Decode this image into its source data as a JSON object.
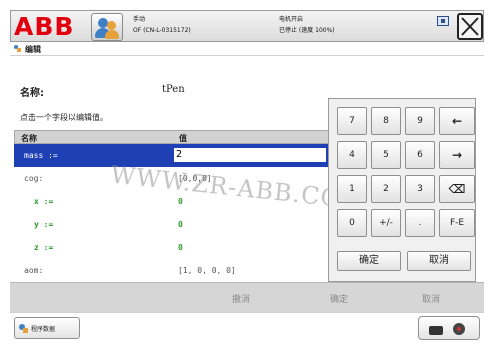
{
  "app": {
    "logo": "ABB",
    "window_title": "编辑"
  },
  "status": {
    "mode": "手动",
    "controller": "OF (CN-L-0315172)",
    "motor": "电机开启",
    "run_state": "已停止 (速度 100%)"
  },
  "editor": {
    "name_label": "名称:",
    "name_value": "tPen",
    "hint": "点击一个字段以编辑值。",
    "columns": [
      "名称",
      "值"
    ],
    "rows": [
      {
        "name": "mass :=",
        "value": "2",
        "selected": true,
        "style": "grey"
      },
      {
        "name": "cog:",
        "value": "[0,0,0]",
        "selected": false,
        "style": "grey"
      },
      {
        "name": "x :=",
        "value": "0",
        "selected": false,
        "style": "green"
      },
      {
        "name": "y :=",
        "value": "0",
        "selected": false,
        "style": "green"
      },
      {
        "name": "z :=",
        "value": "0",
        "selected": false,
        "style": "green"
      },
      {
        "name": "aom:",
        "value": "[1, 0, 0, 0]",
        "selected": false,
        "style": "grey"
      }
    ]
  },
  "watermark": "WWW.ZR-ABB.COM",
  "keypad": {
    "keys": [
      "7",
      "8",
      "9",
      "←",
      "4",
      "5",
      "6",
      "→",
      "1",
      "2",
      "3",
      "⌫",
      "0",
      "+/-",
      ".",
      "F-E"
    ],
    "ok_label": "确定",
    "cancel_label": "取消"
  },
  "actions": {
    "cancel": "撤消",
    "confirm": "确定",
    "abort": "取消"
  },
  "taskbar": {
    "program_data": "程序数据"
  }
}
